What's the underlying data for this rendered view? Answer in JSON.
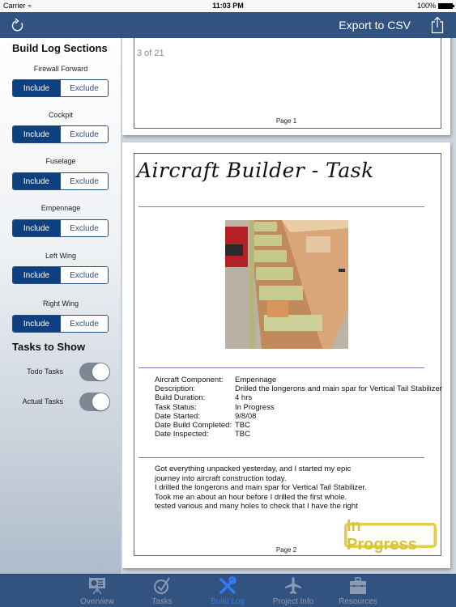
{
  "status_bar": {
    "carrier": "Carrier",
    "time": "11:03 PM",
    "battery": "100%"
  },
  "navbar": {
    "refresh_icon": "refresh-icon",
    "export_label": "Export to CSV",
    "share_icon": "share-icon"
  },
  "sidebar": {
    "sections_title": "Build Log Sections",
    "sections": [
      {
        "label": "Firewall Forward",
        "include": "Include",
        "exclude": "Exclude",
        "selected": "Include"
      },
      {
        "label": "Cockpit",
        "include": "Include",
        "exclude": "Exclude",
        "selected": "Include"
      },
      {
        "label": "Fuselage",
        "include": "Include",
        "exclude": "Exclude",
        "selected": "Include"
      },
      {
        "label": "Empennage",
        "include": "Include",
        "exclude": "Exclude",
        "selected": "Include"
      },
      {
        "label": "Left Wing",
        "include": "Include",
        "exclude": "Exclude",
        "selected": "Include"
      },
      {
        "label": "Right Wing",
        "include": "Include",
        "exclude": "Exclude",
        "selected": "Include"
      }
    ],
    "tasks_title": "Tasks to Show",
    "toggles": [
      {
        "label": "Todo Tasks",
        "on": true
      },
      {
        "label": "Actual Tasks",
        "on": true
      }
    ]
  },
  "document": {
    "page_counter": "3 of 21",
    "page1_label": "Page 1",
    "title": "Aircraft Builder - Task",
    "photo_alt": "Empennage construction photo",
    "details": [
      {
        "key": "Aircraft Component:",
        "value": "Empennage"
      },
      {
        "key": "Description:",
        "value": "Drilled the longerons and main spar for Vertical Tail Stabilizer"
      },
      {
        "key": "Build Duration:",
        "value": "4 hrs"
      },
      {
        "key": "Task Status:",
        "value": "In Progress"
      },
      {
        "key": "Date Started:",
        "value": "9/8/08"
      },
      {
        "key": "Date Build Completed:",
        "value": "TBC"
      },
      {
        "key": "Date Inspected:",
        "value": "TBC"
      }
    ],
    "notes": [
      "Got everything unpacked yesterday, and I started my epic",
      "journey into aircraft construction today.",
      "I drilled the longerons and main spar for Vertical Tail Stabilizer.",
      "Took me an about an hour before I drilled the first whole.",
      "tested various and many holes to check that I have the right"
    ],
    "stamp": "In Progress",
    "page2_label": "Page 2"
  },
  "tabbar": {
    "active": "Build Log",
    "tabs": [
      {
        "label": "Overview",
        "icon": "presentation-icon"
      },
      {
        "label": "Tasks",
        "icon": "check-circle-icon"
      },
      {
        "label": "Build Log",
        "icon": "tools-icon"
      },
      {
        "label": "Project Info",
        "icon": "airplane-icon"
      },
      {
        "label": "Resources",
        "icon": "briefcase-icon"
      }
    ]
  },
  "colors": {
    "nav_bg": "#32527f",
    "segment_selected": "#0e3f7e",
    "tab_active": "#2f7cf6",
    "tab_inactive": "#8c9bb2",
    "stamp": "#e2cc4a",
    "rule_line": "#7b7bd6"
  }
}
